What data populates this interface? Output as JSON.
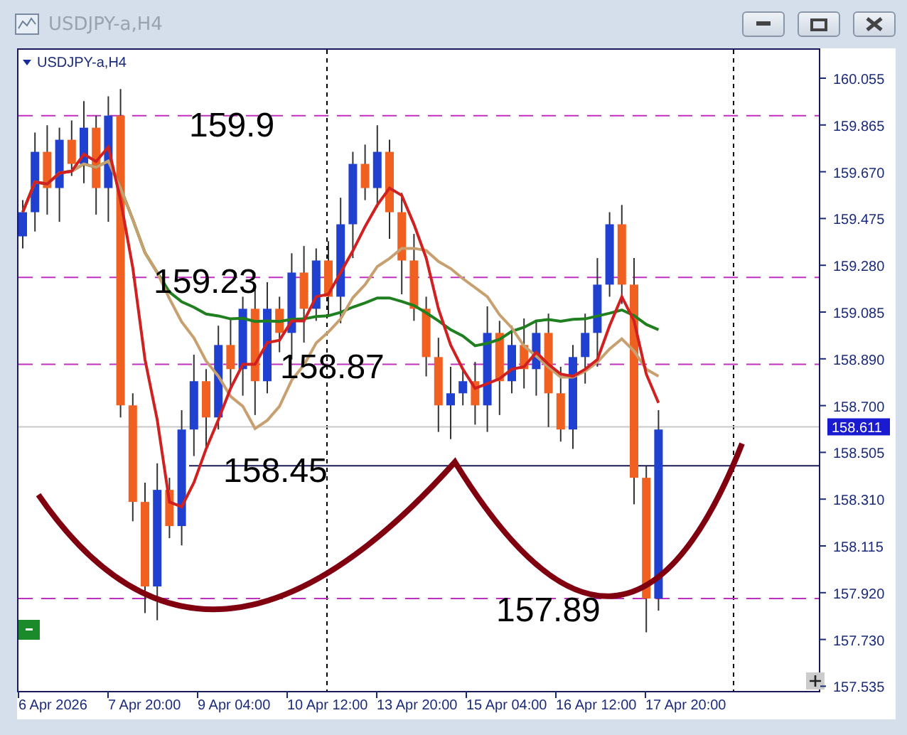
{
  "window": {
    "title": "USDJPY-a,H4"
  },
  "chart": {
    "symbol_label": "USDJPY-a,H4",
    "price_labels": [
      "160.055",
      "159.865",
      "159.670",
      "159.475",
      "159.280",
      "159.085",
      "158.890",
      "158.700",
      "158.505",
      "158.310",
      "158.115",
      "157.920",
      "157.730",
      "157.535"
    ],
    "current_price": "158.611",
    "time_labels": [
      "6 Apr 2026",
      "7 Apr 20:00",
      "9 Apr 04:00",
      "10 Apr 12:00",
      "13 Apr 20:00",
      "15 Apr 04:00",
      "16 Apr 12:00",
      "17 Apr 20:00"
    ],
    "annotations": [
      {
        "text": "159.9"
      },
      {
        "text": "159.23"
      },
      {
        "text": "158.87"
      },
      {
        "text": "158.45"
      },
      {
        "text": "157.89"
      }
    ]
  }
}
